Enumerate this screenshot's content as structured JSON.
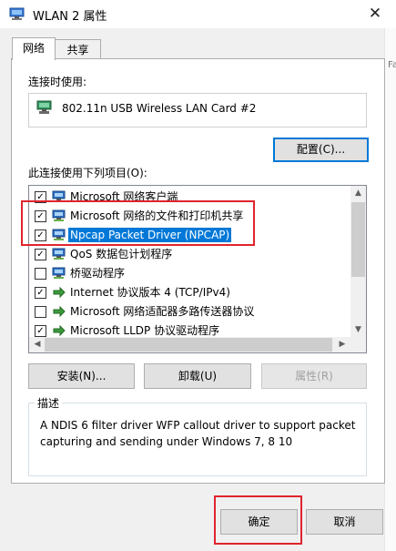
{
  "window": {
    "title": "WLAN 2 属性",
    "close_glyph": "✕"
  },
  "tabs": [
    {
      "label": "网络",
      "active": true
    },
    {
      "label": "共享",
      "active": false
    }
  ],
  "background_window_text": "Fa",
  "connection": {
    "label": "连接时使用:",
    "adapter_name": "802.11n USB Wireless LAN Card #2",
    "configure_button": "配置(C)..."
  },
  "items": {
    "label": "此连接使用下列项目(O):",
    "list": [
      {
        "label": "Microsoft 网络客户端",
        "checked": true,
        "selected": false,
        "icon": "network-client-icon"
      },
      {
        "label": "Microsoft 网络的文件和打印机共享",
        "checked": true,
        "selected": false,
        "icon": "network-client-icon"
      },
      {
        "label": "Npcap Packet Driver (NPCAP)",
        "checked": true,
        "selected": true,
        "icon": "network-client-icon"
      },
      {
        "label": "QoS 数据包计划程序",
        "checked": true,
        "selected": false,
        "icon": "network-client-icon"
      },
      {
        "label": "桥驱动程序",
        "checked": false,
        "selected": false,
        "icon": "network-client-icon"
      },
      {
        "label": "Internet 协议版本 4 (TCP/IPv4)",
        "checked": true,
        "selected": false,
        "icon": "protocol-arrow-icon"
      },
      {
        "label": "Microsoft 网络适配器多路传送器协议",
        "checked": false,
        "selected": false,
        "icon": "protocol-arrow-icon"
      },
      {
        "label": "Microsoft LLDP 协议驱动程序",
        "checked": true,
        "selected": false,
        "icon": "protocol-arrow-icon"
      }
    ]
  },
  "buttons": {
    "install": "安装(N)...",
    "uninstall": "卸载(U)",
    "properties": "属性(R)",
    "ok": "确定",
    "cancel": "取消"
  },
  "description": {
    "legend": "描述",
    "text": "A NDIS 6 filter driver  WFP callout driver to support packet capturing and sending under Windows 7, 8  10"
  },
  "colors": {
    "selection": "#0078d7",
    "annotation_red": "#e0242d"
  }
}
